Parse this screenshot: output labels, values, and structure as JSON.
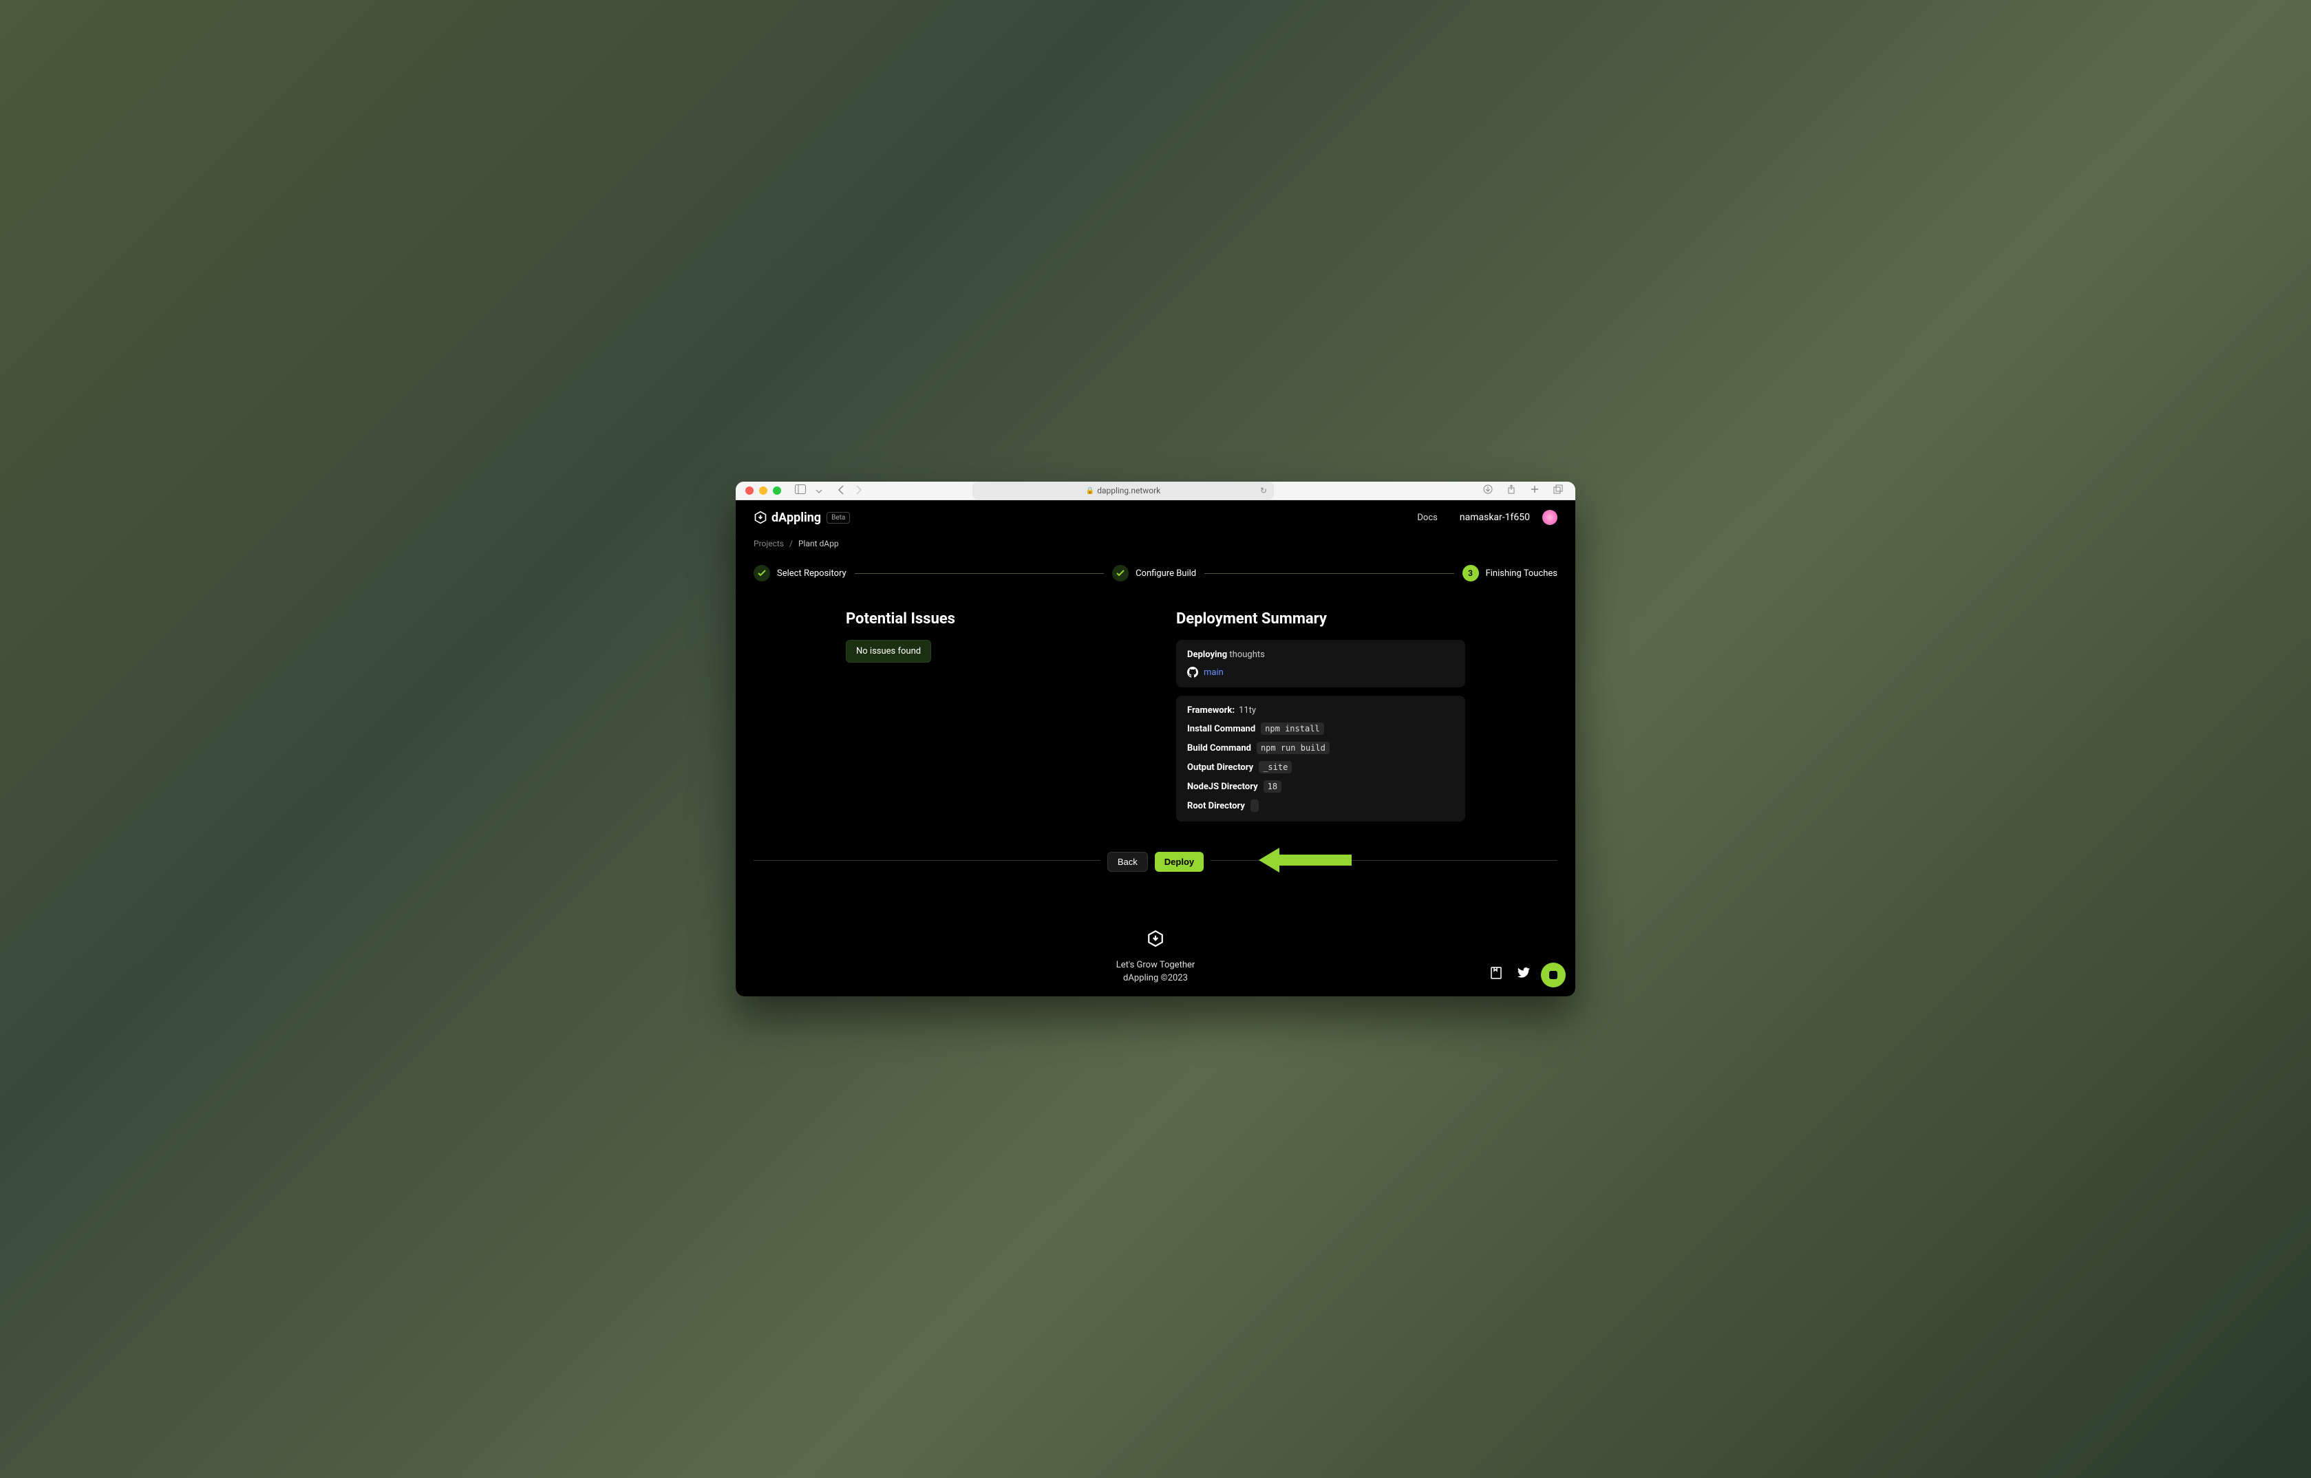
{
  "browser": {
    "url": "dappling.network"
  },
  "header": {
    "logo_text": "dAppling",
    "beta_label": "Beta",
    "docs_label": "Docs",
    "username": "namaskar-1f650"
  },
  "breadcrumb": {
    "items": [
      "Projects",
      "Plant dApp"
    ],
    "separator": "/"
  },
  "stepper": {
    "step1_label": "Select Repository",
    "step2_label": "Configure Build",
    "step3_number": "3",
    "step3_label": "Finishing Touches"
  },
  "issues": {
    "title": "Potential Issues",
    "message": "No issues found"
  },
  "summary": {
    "title": "Deployment Summary",
    "deploying_prefix": "Deploying",
    "deploying_name": "thoughts",
    "branch": "main",
    "config": {
      "framework_label": "Framework:",
      "framework_value": "11ty",
      "install_label": "Install Command",
      "install_value": "npm install",
      "build_label": "Build Command",
      "build_value": "npm run build",
      "output_label": "Output Directory",
      "output_value": "_site",
      "node_label": "NodeJS Directory",
      "node_value": "18",
      "root_label": "Root Directory",
      "root_value": ""
    }
  },
  "actions": {
    "back_label": "Back",
    "deploy_label": "Deploy"
  },
  "footer": {
    "tagline": "Let's Grow Together",
    "copyright": "dAppling ©2023"
  }
}
